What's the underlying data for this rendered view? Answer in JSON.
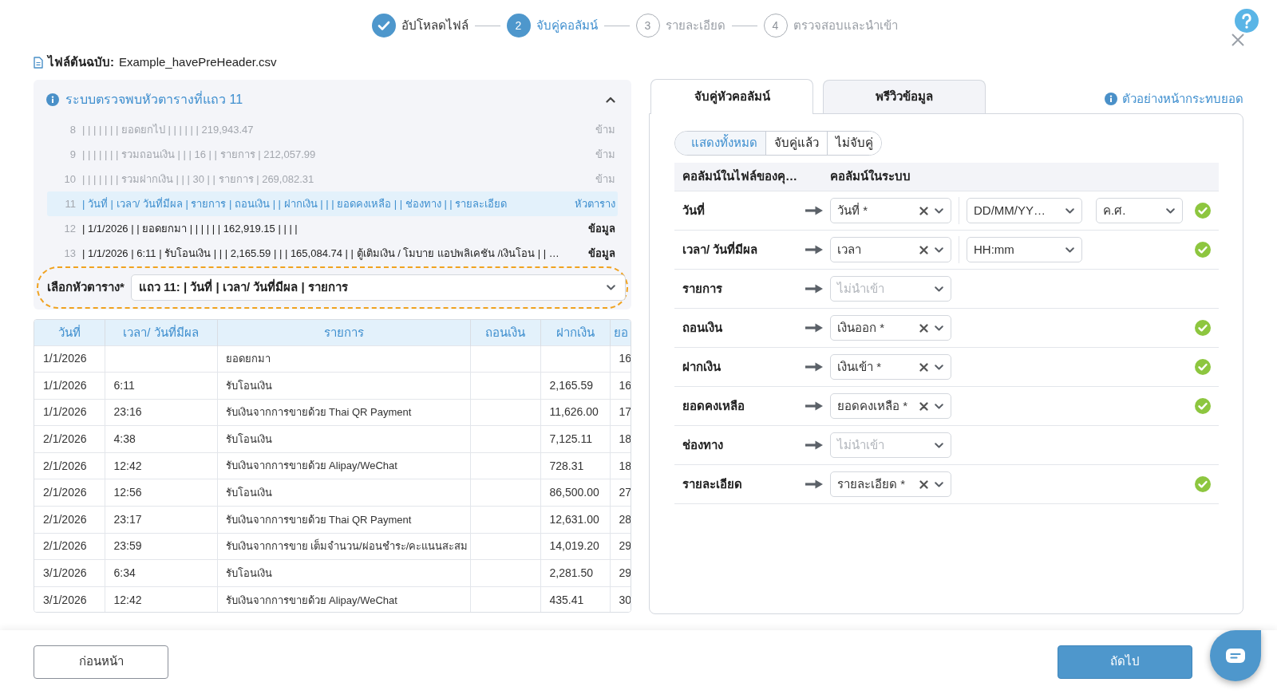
{
  "stepper": {
    "steps": [
      {
        "label": "อัปโหลดไฟล์",
        "completed": true,
        "selected": false
      },
      {
        "number": "2",
        "label": "จับคู่คอลัมน์",
        "completed": false,
        "selected": true
      },
      {
        "number": "3",
        "label": "รายละเอียด",
        "completed": false,
        "selected": false
      },
      {
        "number": "4",
        "label": "ตรวจสอบและนำเข้า",
        "completed": false,
        "selected": false
      }
    ]
  },
  "source_file": {
    "label": "ไฟล์ต้นฉบับ:",
    "name": "Example_havePreHeader.csv"
  },
  "detection_panel": {
    "title": "ระบบตรวจพบหัวตารางที่แถว 11",
    "expanded": true,
    "rows": [
      {
        "number": "8",
        "text": "| | | | | | | ยอดยกไป | | | | | | 219,943.47",
        "tag": "ข้าม",
        "kind": "skip"
      },
      {
        "number": "9",
        "text": "| | | | | | | รวมถอนเงิน | | | 16 | | รายการ | 212,057.99",
        "tag": "ข้าม",
        "kind": "skip"
      },
      {
        "number": "10",
        "text": "| | | | | | | รวมฝากเงิน | | | 30 | | รายการ | 269,082.31",
        "tag": "ข้าม",
        "kind": "skip"
      },
      {
        "number": "11",
        "text": "| วันที่ | เวลา/ วันที่มีผล | รายการ | ถอนเงิน | | ฝากเงิน | | | ยอดคงเหลือ | | ช่องทาง | | รายละเอียด",
        "tag": "หัวตาราง",
        "kind": "header"
      },
      {
        "number": "12",
        "text": "| 1/1/2026 | | ยอดยกมา | | | | | | 162,919.15 | | | |",
        "tag": "ข้อมูล",
        "kind": "data"
      },
      {
        "number": "13",
        "text": "| 1/1/2026 | 6:11 | รับโอนเงิน | | | 2,165.59 | | | 165,084.74 | | ตู้เติมเงิน / โมบาย แอปพลิเคชัน /เงินโอน | | …",
        "tag": "ข้อมูล",
        "kind": "data"
      }
    ],
    "header_select": {
      "label": "เลือกหัวตาราง*",
      "value": "แถว 11: | วันที่ | เวลา/ วันที่มีผล | รายการ"
    }
  },
  "preview_table": {
    "columns": [
      "วันที่",
      "เวลา/ วันที่มีผล",
      "รายการ",
      "ถอนเงิน",
      "ฝากเงิน",
      "ยอ"
    ],
    "rows": [
      [
        "1/1/2026",
        null,
        "ยอดยกมา",
        null,
        null,
        "16"
      ],
      [
        "1/1/2026",
        "6:11",
        "รับโอนเงิน",
        null,
        "2,165.59",
        "16"
      ],
      [
        "1/1/2026",
        "23:16",
        "รับเงินจากการขายด้วย Thai QR Payment",
        null,
        "11,626.00",
        "17"
      ],
      [
        "2/1/2026",
        "4:38",
        "รับโอนเงิน",
        null,
        "7,125.11",
        "18"
      ],
      [
        "2/1/2026",
        "12:42",
        "รับเงินจากการขายด้วย Alipay/WeChat",
        null,
        "728.31",
        "18"
      ],
      [
        "2/1/2026",
        "12:56",
        "รับโอนเงิน",
        null,
        "86,500.00",
        "27"
      ],
      [
        "2/1/2026",
        "23:17",
        "รับเงินจากการขายด้วย Thai QR Payment",
        null,
        "12,631.00",
        "28"
      ],
      [
        "2/1/2026",
        "23:59",
        "รับเงินจากการขาย เต็มจำนวน/ผ่อนชำระ/คะแนนสะสม",
        null,
        "14,019.20",
        "29"
      ],
      [
        "3/1/2026",
        "6:34",
        "รับโอนเงิน",
        null,
        "2,281.50",
        "29"
      ],
      [
        "3/1/2026",
        "12:42",
        "รับเงินจากการขายด้วย Alipay/WeChat",
        null,
        "435.41",
        "30"
      ]
    ]
  },
  "mapping_panel": {
    "tabs": [
      {
        "label": "จับคู่หัวคอลัมน์",
        "selected": true
      },
      {
        "label": "พรีวิวข้อมูล",
        "selected": false
      }
    ],
    "link": "ตัวอย่างหน้ากระทบยอด",
    "filters": [
      {
        "label": "แสดงทั้งหมด",
        "selected": true
      },
      {
        "label": "จับคู่แล้ว",
        "selected": false
      },
      {
        "label": "ไม่จับคู่",
        "selected": false
      }
    ],
    "columns": [
      "คอลัมน์ในไฟล์ของคุ…",
      "คอลัมน์ในระบบ"
    ],
    "rows": [
      {
        "source": "วันที่",
        "target": {
          "value": "วันที่ *"
        },
        "formats": [
          {
            "value": "DD/MM/YY…"
          },
          {
            "value": "ค.ศ."
          }
        ],
        "matched": true
      },
      {
        "source": "เวลา/ วันที่มีผล",
        "target": {
          "value": "เวลา"
        },
        "formats": [
          {
            "value": "HH:mm"
          }
        ],
        "matched": true
      },
      {
        "source": "รายการ",
        "target": {
          "placeholder": "ไม่นำเข้า"
        },
        "matched": false
      },
      {
        "source": "ถอนเงิน",
        "target": {
          "value": "เงินออก *"
        },
        "matched": true
      },
      {
        "source": "ฝากเงิน",
        "target": {
          "value": "เงินเข้า *"
        },
        "matched": true
      },
      {
        "source": "ยอดคงเหลือ",
        "target": {
          "value": "ยอดคงเหลือ *"
        },
        "matched": true
      },
      {
        "source": "ช่องทาง",
        "target": {
          "placeholder": "ไม่นำเข้า"
        },
        "matched": false
      },
      {
        "source": "รายละเอียด",
        "target": {
          "value": "รายละเอียด *"
        },
        "matched": true
      }
    ]
  },
  "footer": {
    "buttons": [
      {
        "label": "ก่อนหน้า",
        "kind": "secondary"
      },
      {
        "label": "ถัดไป",
        "kind": "primary"
      }
    ]
  }
}
